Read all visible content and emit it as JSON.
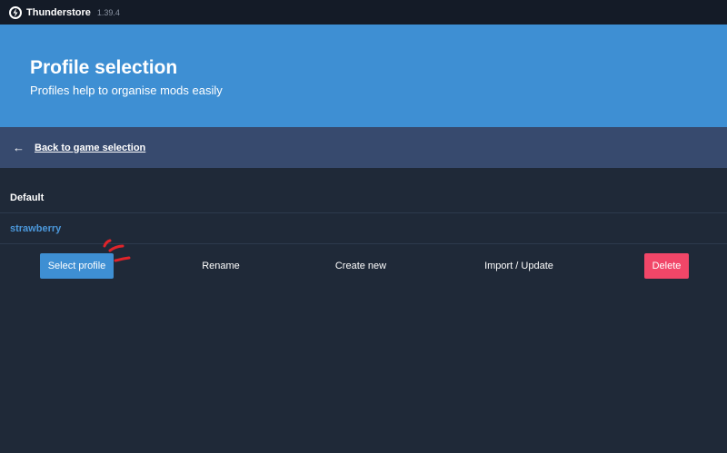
{
  "titlebar": {
    "icon": "thunderstore-logo-icon",
    "app_name": "Thunderstore",
    "version": "1.39.4"
  },
  "hero": {
    "title": "Profile selection",
    "subtitle": "Profiles help to organise mods easily"
  },
  "back": {
    "arrow": "←",
    "label": "Back to game selection"
  },
  "profiles": [
    {
      "name": "Default",
      "selected": false
    },
    {
      "name": "strawberry",
      "selected": true
    }
  ],
  "actions": {
    "select": "Select profile",
    "rename": "Rename",
    "create": "Create new",
    "import": "Import / Update",
    "delete": "Delete"
  },
  "colors": {
    "titlebar_bg": "#141b27",
    "hero_bg": "#3e8fd3",
    "backbar_bg": "#374a6e",
    "page_bg": "#1f2938",
    "selected_text": "#4b97da",
    "primary": "#3e8fd3",
    "danger": "#f14668",
    "annotation_marks": "#e0242a"
  }
}
